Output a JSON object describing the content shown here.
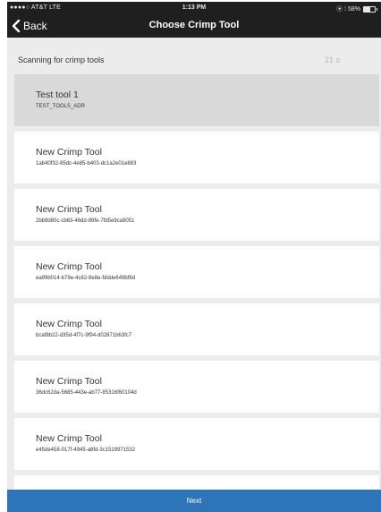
{
  "status_bar": {
    "carrier": "●●●●○ AT&T  LTE",
    "time": "1:13 PM",
    "right_text": "⦿ ⁞ 58%"
  },
  "nav": {
    "back_label": "Back",
    "title": "Choose Crimp Tool"
  },
  "scan": {
    "label": "Scanning for crimp tools",
    "timer": "21 s"
  },
  "tools": [
    {
      "name": "Test tool 1",
      "id": "TEST_TOOLS_ADR",
      "selected": true
    },
    {
      "name": "New Crimp Tool",
      "id": "1ab40f32-85dc-4e85-b403-dc1a2e01e883",
      "selected": false
    },
    {
      "name": "New Crimp Tool",
      "id": "2bb9d80c-cb63-46dd-89fe-7fd5e9ca9051",
      "selected": false
    },
    {
      "name": "New Crimp Tool",
      "id": "ea99b014-b79e-4c82-8e8e-fddde649bf8d",
      "selected": false
    },
    {
      "name": "New Crimp Tool",
      "id": "bcaf8b22-d35d-4f7c-9f94-d02871b63fc7",
      "selected": false
    },
    {
      "name": "New Crimp Tool",
      "id": "36dc62da-5685-443e-ab77-85316f60104d",
      "selected": false
    },
    {
      "name": "New Crimp Tool",
      "id": "e45de458-017f-4945-a8fd-3c1519971532",
      "selected": false
    },
    {
      "name": "",
      "id": "",
      "selected": false
    }
  ],
  "footer": {
    "next_label": "Next"
  },
  "colors": {
    "bar_background": "#1f1f1f",
    "primary_button": "#2d74b8",
    "selected_row": "#d9d9d9",
    "screen_background": "#ececec"
  },
  "icons": {
    "back": "chevron-left-icon",
    "battery": "battery-icon"
  }
}
